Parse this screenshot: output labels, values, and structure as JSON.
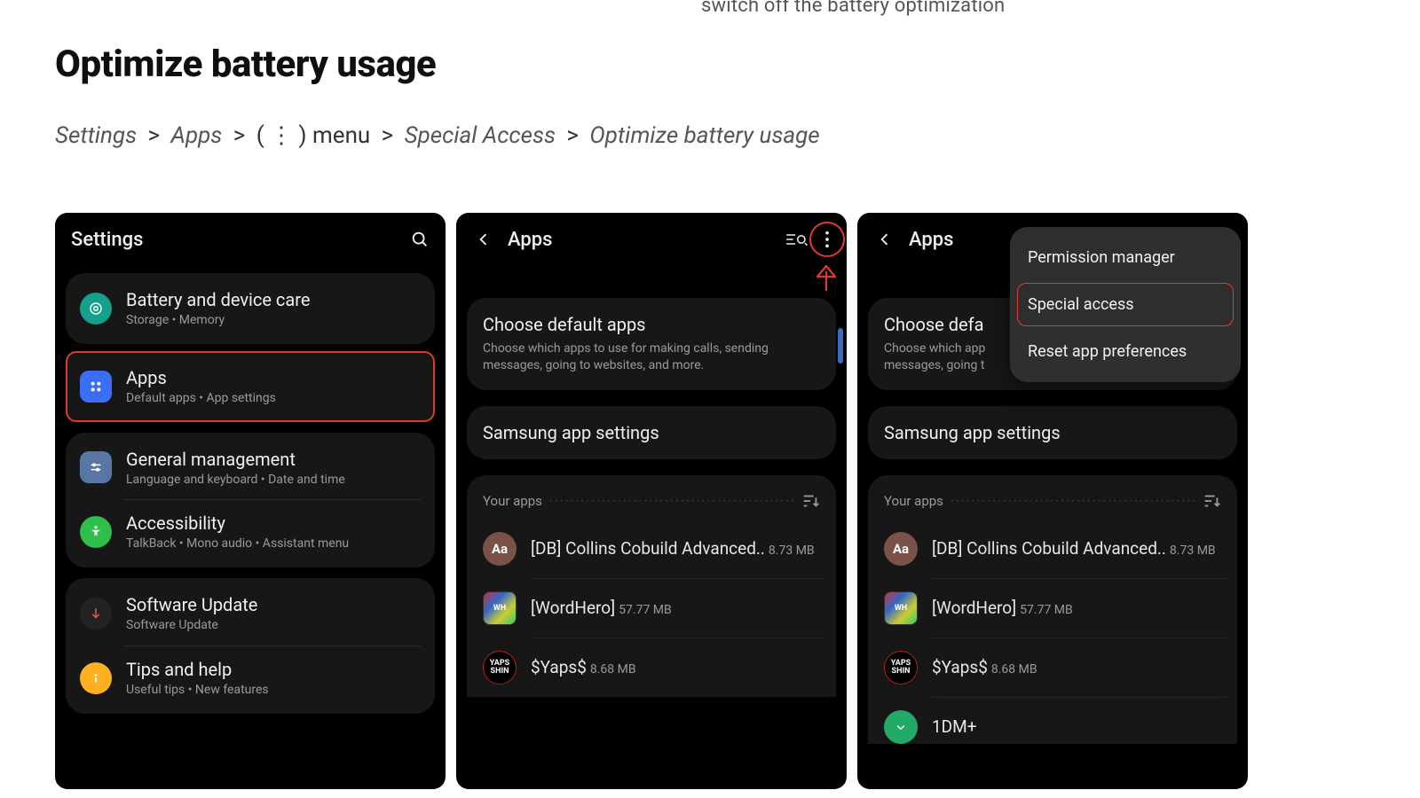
{
  "header_cut": "switch off the battery optimization",
  "title": "Optimize battery usage",
  "breadcrumb": {
    "parts": [
      "Settings",
      "Apps",
      "( ⋮ ) menu",
      "Special Access",
      "Optimize battery usage"
    ]
  },
  "screen1": {
    "title": "Settings",
    "items": [
      {
        "label": "Battery and device care",
        "sub": "Storage  •  Memory"
      },
      {
        "label": "Apps",
        "sub": "Default apps  •  App settings"
      },
      {
        "label": "General management",
        "sub": "Language and keyboard  •  Date and time"
      },
      {
        "label": "Accessibility",
        "sub": "TalkBack  •  Mono audio  •  Assistant menu"
      },
      {
        "label": "Software Update",
        "sub": "Software Update"
      },
      {
        "label": "Tips and help",
        "sub": "Useful tips  •  New features"
      }
    ]
  },
  "screen2": {
    "title": "Apps",
    "default_card": {
      "title": "Choose default apps",
      "desc": "Choose which apps to use for making calls, sending messages, going to websites, and more."
    },
    "samsung_card": {
      "title": "Samsung app settings"
    },
    "your_apps_label": "Your apps",
    "apps": [
      {
        "label": "[DB] Collins Cobuild Advanced..",
        "sub": "8.73 MB"
      },
      {
        "label": "[WordHero]",
        "sub": "57.77 MB"
      },
      {
        "label": "$Yaps$",
        "sub": "8.68 MB"
      }
    ]
  },
  "screen3": {
    "title": "Apps",
    "menu": {
      "items": [
        "Permission manager",
        "Special access",
        "Reset app preferences"
      ]
    },
    "default_card": {
      "title": "Choose defa",
      "desc_l1": "Choose which app",
      "desc_l2": "messages, going t"
    },
    "samsung_card": {
      "title": "Samsung app settings"
    },
    "your_apps_label": "Your apps",
    "apps": [
      {
        "label": "[DB] Collins Cobuild Advanced..",
        "sub": "8.73 MB"
      },
      {
        "label": "[WordHero]",
        "sub": "57.77 MB"
      },
      {
        "label": "$Yaps$",
        "sub": "8.68 MB"
      },
      {
        "label": "1DM+",
        "sub": ""
      }
    ]
  }
}
